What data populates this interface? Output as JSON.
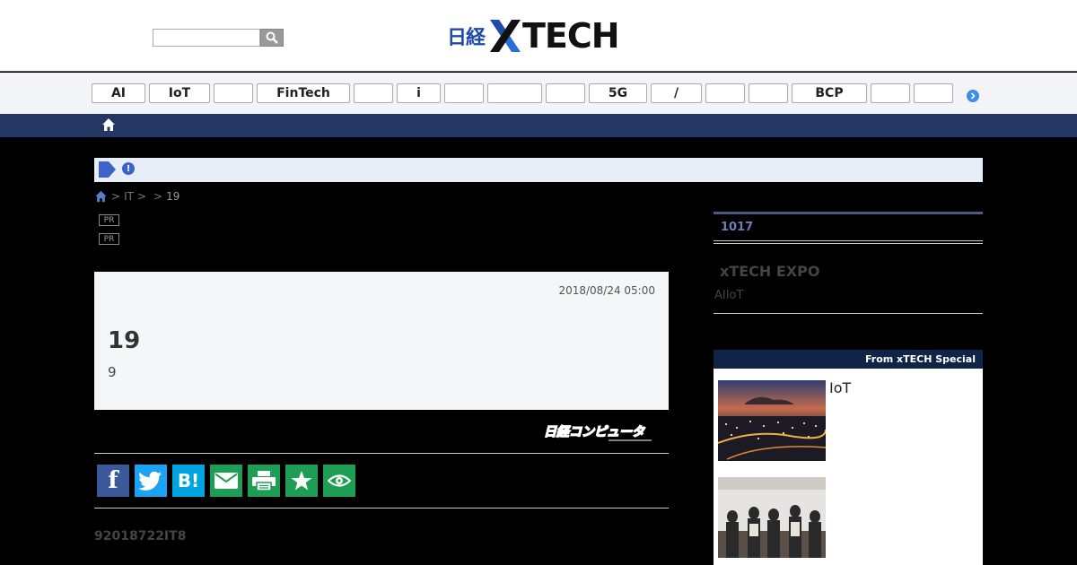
{
  "header": {
    "search": {
      "placeholder": "",
      "value": ""
    },
    "logo": {
      "nikkei": "日経",
      "tech": "TECH"
    },
    "colors": {
      "logo_blue": "#1e4aa8",
      "nav_bar": "#243663"
    }
  },
  "topics": [
    "AI",
    "IoT",
    "",
    "FinTech",
    "",
    "i",
    "",
    "",
    "",
    "5G",
    "/",
    "",
    "",
    "BCP",
    "",
    ""
  ],
  "notice": {
    "icon": "info-icon"
  },
  "breadcrumb": {
    "sep1": ">",
    "item1": "IT",
    "sep2": ">",
    "sep3": ">",
    "current": "19"
  },
  "pr_badges": [
    "PR",
    "PR"
  ],
  "article": {
    "date": "2018/08/24 05:00",
    "title": "19",
    "subtitle": "9",
    "source": "日経コンピュータ"
  },
  "share_buttons": [
    {
      "name": "facebook",
      "icon": "facebook-icon",
      "label": "f",
      "color": "#3b5998"
    },
    {
      "name": "twitter",
      "icon": "twitter-icon",
      "label": "",
      "color": "#1da1f2"
    },
    {
      "name": "hatena",
      "icon": "hatena-bookmark-icon",
      "label": "B!",
      "color": "#00a4de"
    },
    {
      "name": "mail",
      "icon": "mail-icon",
      "label": "",
      "color": "#1e9e55"
    },
    {
      "name": "print",
      "icon": "print-icon",
      "label": "",
      "color": "#1e9e55"
    },
    {
      "name": "favorite",
      "icon": "star-icon",
      "label": "",
      "color": "#1e9e55"
    },
    {
      "name": "watch",
      "icon": "eye-icon",
      "label": "",
      "color": "#1e9e55"
    }
  ],
  "lead": "92018722IT8",
  "sidebar": {
    "ranking_label": "1017",
    "expo": {
      "title": "xTECH EXPO",
      "subtitle": "AIIoT"
    },
    "special": {
      "heading": "From  xTECH Special",
      "items": [
        {
          "text": "IoT"
        },
        {
          "text": ""
        }
      ]
    }
  }
}
